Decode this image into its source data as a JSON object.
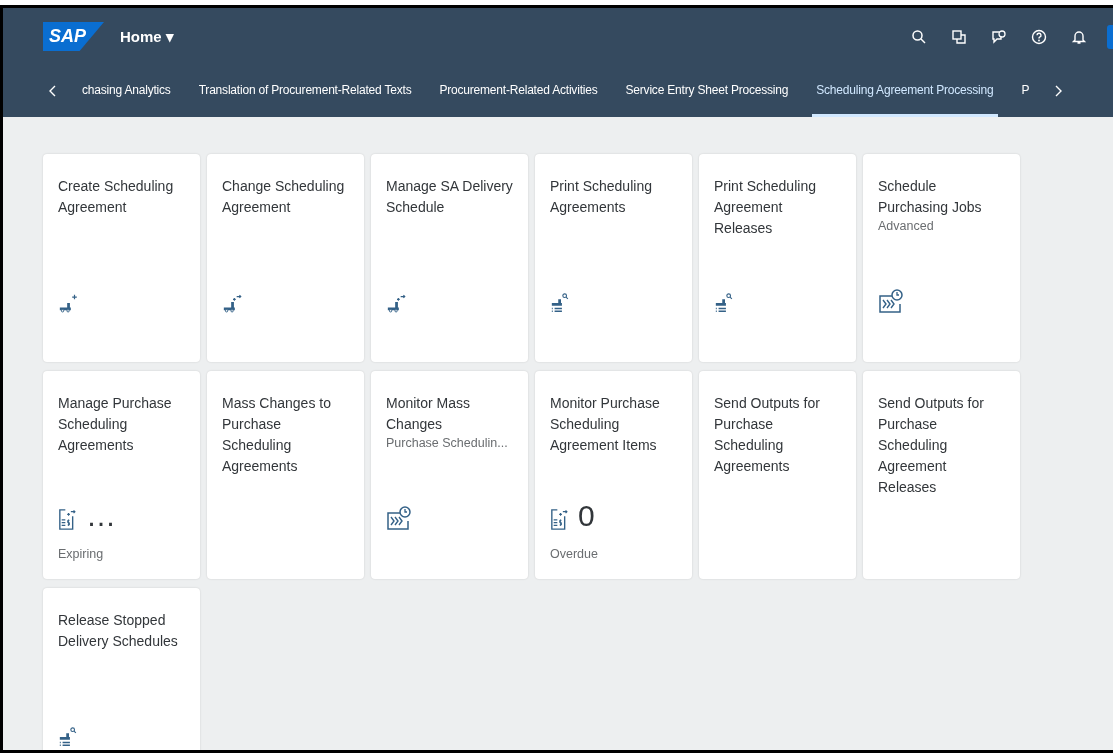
{
  "shell": {
    "logo": "SAP",
    "title": "Home ▾"
  },
  "tabs": [
    {
      "label": "chasing Analytics",
      "selected": false
    },
    {
      "label": "Translation of Procurement-Related Texts",
      "selected": false
    },
    {
      "label": "Procurement-Related Activities",
      "selected": false
    },
    {
      "label": "Service Entry Sheet Processing",
      "selected": false
    },
    {
      "label": "Scheduling Agreement Processing",
      "selected": true
    },
    {
      "label": "P",
      "selected": false
    }
  ],
  "tiles": [
    {
      "title": "Create Scheduling Agreement",
      "kind": "create"
    },
    {
      "title": "Change Scheduling Agreement",
      "kind": "change"
    },
    {
      "title": "Manage SA Delivery Schedule",
      "kind": "change"
    },
    {
      "title": "Print Scheduling Agreements",
      "kind": "print"
    },
    {
      "title": "Print Scheduling Agreement Releases",
      "kind": "print"
    },
    {
      "title": "Schedule Purchasing Jobs",
      "subtitle": "Advanced",
      "kind": "jobs"
    },
    {
      "title": "Manage Purchase Scheduling Agreements",
      "kind": "kpi",
      "number": "…",
      "footer": "Expiring"
    },
    {
      "title": "Mass Changes to Purchase Scheduling Agreements",
      "kind": "plain"
    },
    {
      "title": "Monitor Mass Changes",
      "subtitle": "Purchase Schedulin...",
      "kind": "jobs"
    },
    {
      "title": "Monitor Purchase Scheduling Agreement Items",
      "kind": "kpi",
      "number": "0",
      "footer": "Overdue"
    },
    {
      "title": "Send Outputs for Purchase Scheduling Agreements",
      "kind": "plain"
    },
    {
      "title": "Send Outputs for Purchase Scheduling Agreement Releases",
      "kind": "plain"
    },
    {
      "title": "Release Stopped Delivery Schedules",
      "kind": "print"
    }
  ]
}
